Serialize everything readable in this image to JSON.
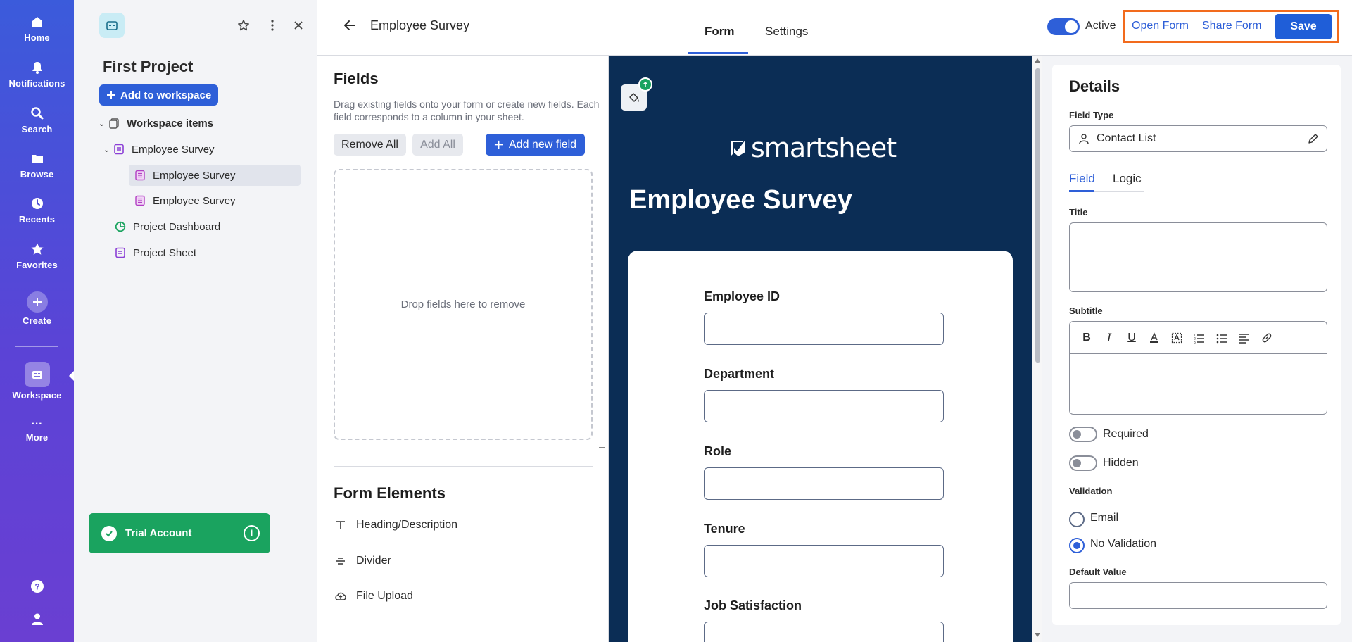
{
  "rail": {
    "items": [
      {
        "label": "Home",
        "icon": "home-icon"
      },
      {
        "label": "Notifications",
        "icon": "bell-icon"
      },
      {
        "label": "Search",
        "icon": "search-icon"
      },
      {
        "label": "Browse",
        "icon": "folder-icon"
      },
      {
        "label": "Recents",
        "icon": "clock-icon"
      },
      {
        "label": "Favorites",
        "icon": "star-icon"
      },
      {
        "label": "Create",
        "icon": "plus-icon"
      },
      {
        "label": "Workspace",
        "icon": "workspace-icon"
      },
      {
        "label": "More",
        "icon": "ellipsis-icon"
      }
    ],
    "accent": "#3b5bdb"
  },
  "workspace": {
    "title": "First Project",
    "add_label": "Add to workspace",
    "tree": [
      {
        "label": "Workspace items",
        "icon": "workspace-items-icon"
      },
      {
        "label": "Employee Survey",
        "icon": "sheet-icon"
      },
      {
        "label": "Employee Survey",
        "icon": "form-icon",
        "selected": true
      },
      {
        "label": "Employee Survey",
        "icon": "form-icon"
      },
      {
        "label": "Project Dashboard",
        "icon": "dashboard-icon"
      },
      {
        "label": "Project Sheet",
        "icon": "sheet-icon"
      }
    ],
    "trial_label": "Trial Account"
  },
  "topbar": {
    "doc_title": "Employee Survey",
    "tabs": [
      "Form",
      "Settings"
    ],
    "active_tab": "Form",
    "toggle_label": "Active",
    "toggle_on": true,
    "open_form": "Open Form",
    "share_form": "Share Form",
    "save": "Save",
    "highlight_color": "#f26b1d"
  },
  "fields_panel": {
    "title": "Fields",
    "description": "Drag existing fields onto your form or create new fields. Each field corresponds to a column in your sheet.",
    "remove_all": "Remove All",
    "add_all": "Add All",
    "add_new": "Add new field",
    "dropzone": "Drop fields here to remove",
    "elements_title": "Form Elements",
    "elements": [
      {
        "label": "Heading/Description",
        "icon": "heading-icon"
      },
      {
        "label": "Divider",
        "icon": "divider-icon"
      },
      {
        "label": "File Upload",
        "icon": "upload-icon"
      }
    ]
  },
  "preview": {
    "brand": "smartsheet",
    "title": "Employee Survey",
    "background": "#0b2d55",
    "questions": [
      "Employee ID",
      "Department",
      "Role",
      "Tenure",
      "Job Satisfaction"
    ]
  },
  "details": {
    "title": "Details",
    "field_type_label": "Field Type",
    "field_type_value": "Contact List",
    "tabs": [
      "Field",
      "Logic"
    ],
    "active_tab": "Field",
    "title_label": "Title",
    "subtitle_label": "Subtitle",
    "toolbar": [
      "B",
      "I",
      "U"
    ],
    "required_label": "Required",
    "hidden_label": "Hidden",
    "validation_label": "Validation",
    "validation_options": [
      "Email",
      "No Validation"
    ],
    "validation_selected": "No Validation",
    "default_value_label": "Default Value"
  }
}
